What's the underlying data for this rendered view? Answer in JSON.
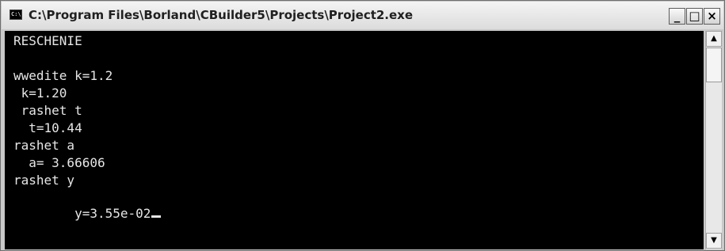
{
  "window": {
    "title": "C:\\Program Files\\Borland\\CBuilder5\\Projects\\Project2.exe",
    "icon_name": "console-app-icon",
    "icon_text": "C:\\",
    "minimize_glyph": "_",
    "maximize_glyph": "□",
    "close_glyph": "×"
  },
  "console": {
    "lines": [
      "RESCHENIE",
      "",
      "wwedite k=1.2",
      " k=1.20",
      " rashet t",
      "  t=10.44",
      "rashet a",
      "  a= 3.66606",
      "rashet y",
      "  y=3.55e-02"
    ],
    "text_color": "#e6e6e6",
    "background": "#000000"
  },
  "scrollbar": {
    "up_glyph": "▲",
    "down_glyph": "▼"
  }
}
